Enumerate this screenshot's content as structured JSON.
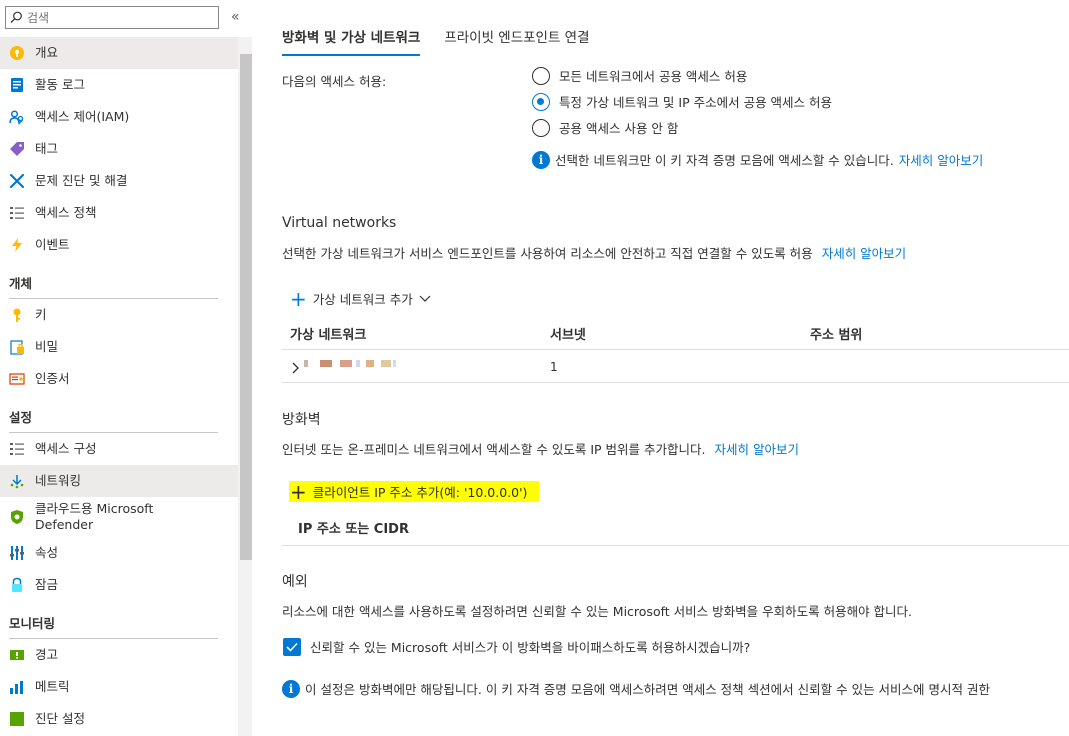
{
  "sidebar": {
    "search_placeholder": "검색",
    "collapse_glyph": "«",
    "items_top": [
      {
        "label": "개요"
      },
      {
        "label": "활동 로그"
      },
      {
        "label": "액세스 제어(IAM)"
      },
      {
        "label": "태그"
      },
      {
        "label": "문제 진단 및 해결"
      },
      {
        "label": "액세스 정책"
      },
      {
        "label": "이벤트"
      }
    ],
    "section_objects": "개체",
    "items_objects": [
      {
        "label": "키"
      },
      {
        "label": "비밀"
      },
      {
        "label": "인증서"
      }
    ],
    "section_settings": "설정",
    "items_settings": [
      {
        "label": "액세스 구성"
      },
      {
        "label": "네트워킹"
      },
      {
        "label": "클라우드용 Microsoft Defender"
      },
      {
        "label": "속성"
      },
      {
        "label": "잠금"
      }
    ],
    "section_monitoring": "모니터링",
    "items_monitoring": [
      {
        "label": "경고"
      },
      {
        "label": "메트릭"
      },
      {
        "label": "진단 설정"
      }
    ]
  },
  "tabs": [
    "방화벽 및 가상 네트워크",
    "프라이빗 엔드포인트 연결"
  ],
  "access": {
    "label": "다음의 액세스 허용:",
    "options": [
      {
        "label": "모든 네트워크에서 공용 액세스 허용",
        "checked": false
      },
      {
        "label": "특정 가상 네트워크 및 IP 주소에서 공용 액세스 허용",
        "checked": true
      },
      {
        "label": "공용 액세스 사용 안 함",
        "checked": false
      }
    ],
    "info_text": "선택한 네트워크만 이 키 자격 증명 모음에 액세스할 수 있습니다.",
    "info_link": "자세히 알아보기"
  },
  "vnet": {
    "title": "Virtual networks",
    "desc": "선택한 가상 네트워크가 서비스 엔드포인트를 사용하여 리소스에 안전하고 직접 연결할 수 있도록 허용",
    "desc_link": "자세히 알아보기",
    "add_label": "가상 네트워크 추가",
    "columns": [
      "가상 네트워크",
      "서브넷",
      "주소 범위"
    ],
    "rows": [
      {
        "subnets": "1"
      }
    ]
  },
  "firewall": {
    "title": "방화벽",
    "desc": "인터넷 또는 온-프레미스 네트워크에서 액세스할 수 있도록 IP 범위를 추가합니다.",
    "desc_link": "자세히 알아보기",
    "add_ip_label": "클라이언트 IP 주소 추가(예: '10.0.0.0')",
    "column": "IP 주소 또는 CIDR"
  },
  "exceptions": {
    "title": "예외",
    "desc": "리소스에 대한 액세스를 사용하도록 설정하려면 신뢰할 수 있는 Microsoft 서비스 방화벽을 우회하도록 허용해야 합니다.",
    "checkbox_label": "신뢰할 수 있는 Microsoft 서비스가 이 방화벽을 바이패스하도록 허용하시겠습니까?",
    "checkbox_checked": true,
    "info_text": "이 설정은 방화벽에만 해당됩니다. 이 키 자격 증명 모음에 액세스하려면 액세스 정책 섹션에서 신뢰할 수 있는 서비스에 명시적 권한"
  },
  "colors": {
    "accent": "#0078d4",
    "highlight": "#ffff00",
    "selected_bg": "#edebe9"
  }
}
